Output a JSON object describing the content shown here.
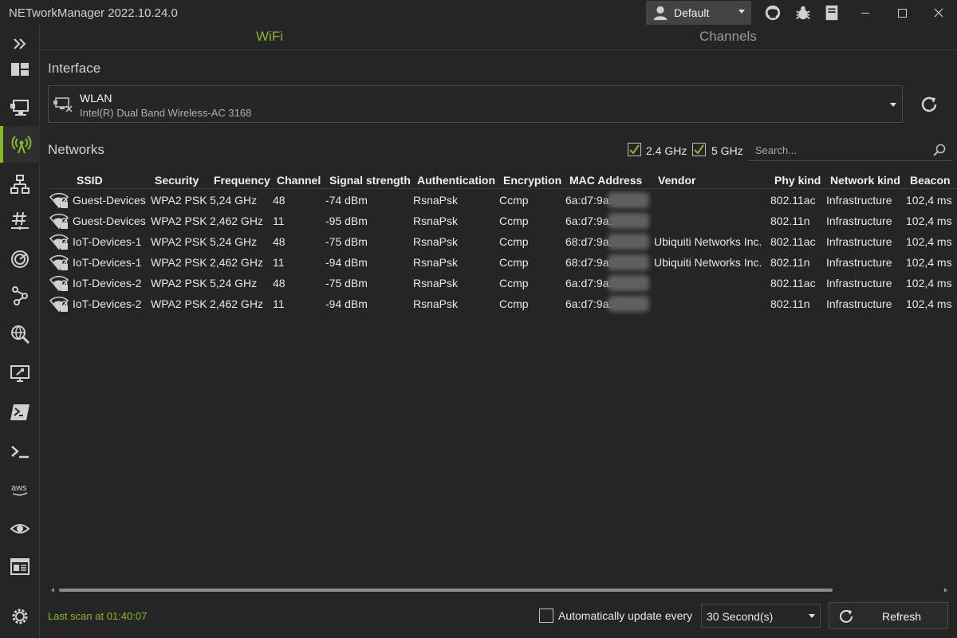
{
  "window": {
    "title": "NETworkManager 2022.10.24.0",
    "profile": "Default",
    "icons": [
      "github-icon",
      "bug-icon",
      "docs-icon",
      "minimize-icon",
      "maximize-icon",
      "close-icon"
    ]
  },
  "sidebar": {
    "items": [
      {
        "name": "dashboard",
        "icon": "dashboard-icon"
      },
      {
        "name": "network-interface",
        "icon": "network-interface-icon"
      },
      {
        "name": "wifi",
        "icon": "wifi-antenna-icon",
        "active": true
      },
      {
        "name": "ip-scanner",
        "icon": "ip-scanner-icon"
      },
      {
        "name": "port-scanner",
        "icon": "port-scanner-icon"
      },
      {
        "name": "ping-monitor",
        "icon": "ping-monitor-icon"
      },
      {
        "name": "traceroute",
        "icon": "traceroute-icon"
      },
      {
        "name": "dns-lookup",
        "icon": "dns-lookup-icon"
      },
      {
        "name": "remote-desktop",
        "icon": "remote-desktop-icon"
      },
      {
        "name": "powershell",
        "icon": "powershell-icon"
      },
      {
        "name": "putty",
        "icon": "terminal-icon"
      },
      {
        "name": "aws",
        "icon": "aws-icon"
      },
      {
        "name": "tigervnc",
        "icon": "eye-icon"
      },
      {
        "name": "web-console",
        "icon": "web-console-icon"
      },
      {
        "name": "settings",
        "icon": "gear-icon"
      }
    ],
    "accent": "#8ab823"
  },
  "tabs": [
    {
      "label": "WiFi",
      "active": true
    },
    {
      "label": "Channels",
      "active": false
    }
  ],
  "interface": {
    "section_title": "Interface",
    "name": "WLAN",
    "description": "Intel(R) Dual Band Wireless-AC 3168"
  },
  "networks": {
    "section_title": "Networks",
    "filter_24": {
      "label": "2.4 GHz",
      "checked": true
    },
    "filter_5": {
      "label": "5 GHz",
      "checked": true
    },
    "search_placeholder": "Search...",
    "columns": [
      "SSID",
      "Security",
      "Frequency",
      "Channel",
      "Signal strength",
      "Authentication",
      "Encryption",
      "MAC Address",
      "Vendor",
      "Phy kind",
      "Network kind",
      "Beacon"
    ],
    "rows": [
      {
        "ssid": "Guest-Devices",
        "security": "WPA2 PSK",
        "frequency": "5,24 GHz",
        "channel": "48",
        "signal": "-74 dBm",
        "auth": "RsnaPsk",
        "encryption": "Ccmp",
        "mac": "6a:d7:9a:",
        "vendor": "",
        "phy": "802.11ac",
        "kind": "Infrastructure",
        "beacon": "102,4 ms"
      },
      {
        "ssid": "Guest-Devices",
        "security": "WPA2 PSK",
        "frequency": "2,462 GHz",
        "channel": "11",
        "signal": "-95 dBm",
        "auth": "RsnaPsk",
        "encryption": "Ccmp",
        "mac": "6a:d7:9a:",
        "vendor": "",
        "phy": "802.11n",
        "kind": "Infrastructure",
        "beacon": "102,4 ms"
      },
      {
        "ssid": "IoT-Devices-1",
        "security": "WPA2 PSK",
        "frequency": "5,24 GHz",
        "channel": "48",
        "signal": "-75 dBm",
        "auth": "RsnaPsk",
        "encryption": "Ccmp",
        "mac": "68:d7:9a:",
        "vendor": "Ubiquiti Networks Inc.",
        "phy": "802.11ac",
        "kind": "Infrastructure",
        "beacon": "102,4 ms"
      },
      {
        "ssid": "IoT-Devices-1",
        "security": "WPA2 PSK",
        "frequency": "2,462 GHz",
        "channel": "11",
        "signal": "-94 dBm",
        "auth": "RsnaPsk",
        "encryption": "Ccmp",
        "mac": "68:d7:9a:",
        "vendor": "Ubiquiti Networks Inc.",
        "phy": "802.11n",
        "kind": "Infrastructure",
        "beacon": "102,4 ms"
      },
      {
        "ssid": "IoT-Devices-2",
        "security": "WPA2 PSK",
        "frequency": "5,24 GHz",
        "channel": "48",
        "signal": "-75 dBm",
        "auth": "RsnaPsk",
        "encryption": "Ccmp",
        "mac": "6a:d7:9a:",
        "vendor": "",
        "phy": "802.11ac",
        "kind": "Infrastructure",
        "beacon": "102,4 ms"
      },
      {
        "ssid": "IoT-Devices-2",
        "security": "WPA2 PSK",
        "frequency": "2,462 GHz",
        "channel": "11",
        "signal": "-94 dBm",
        "auth": "RsnaPsk",
        "encryption": "Ccmp",
        "mac": "6a:d7:9a:",
        "vendor": "",
        "phy": "802.11n",
        "kind": "Infrastructure",
        "beacon": "102,4 ms"
      }
    ]
  },
  "footer": {
    "last_scan": "Last scan at 01:40:07",
    "auto_update_label": "Automatically update every",
    "auto_update_checked": false,
    "interval": "30 Second(s)",
    "refresh_label": "Refresh"
  }
}
